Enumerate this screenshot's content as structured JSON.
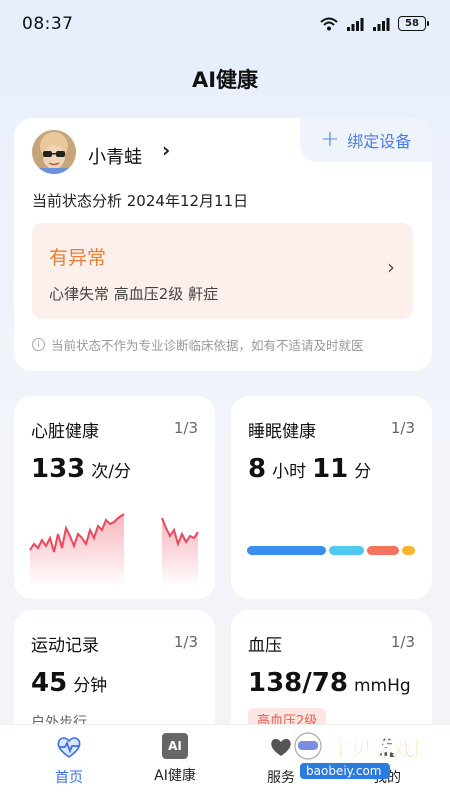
{
  "status_bar": {
    "time": "08:37",
    "battery": "58"
  },
  "page_title": "AI健康",
  "profile": {
    "bind_label": "绑定设备",
    "user_name": "小青蛙",
    "status_date": "当前状态分析 2024年12月11日",
    "alert_title": "有异常",
    "alert_items": "心律失常 高血压2级 鼾症",
    "disclaimer": "当前状态不作为专业诊断临床依据，如有不适请及时就医"
  },
  "cards": {
    "heart": {
      "title": "心脏健康",
      "page": "1/3",
      "value": "133",
      "unit": "次/分"
    },
    "sleep": {
      "title": "睡眠健康",
      "page": "1/3",
      "hours": "8",
      "hours_unit": "小时",
      "minutes": "11",
      "minutes_unit": "分",
      "segments": [
        {
          "share": 0.54,
          "color": "#3b8ef0"
        },
        {
          "share": 0.24,
          "color": "#4fc9ef"
        },
        {
          "share": 0.22,
          "color": "#f2735e"
        },
        {
          "share": 0.09,
          "color": "#f5b731"
        }
      ]
    },
    "sport": {
      "title": "运动记录",
      "page": "1/3",
      "value": "45",
      "unit": "分钟",
      "sub": "户外步行"
    },
    "bp": {
      "title": "血压",
      "page": "1/3",
      "value": "138/78",
      "unit": "mmHg",
      "badge": "高血压2级"
    }
  },
  "tabbar": {
    "home": "首页",
    "ai": "AI健康",
    "ai_icon_text": "AI",
    "service": "服务",
    "mine": "我的"
  },
  "watermark": {
    "text": "宝贝游戏网",
    "url": "baobeiy.com"
  },
  "colors": {
    "accent": "#3d6fe0",
    "warning": "#e48232",
    "danger": "#e65c4f"
  }
}
